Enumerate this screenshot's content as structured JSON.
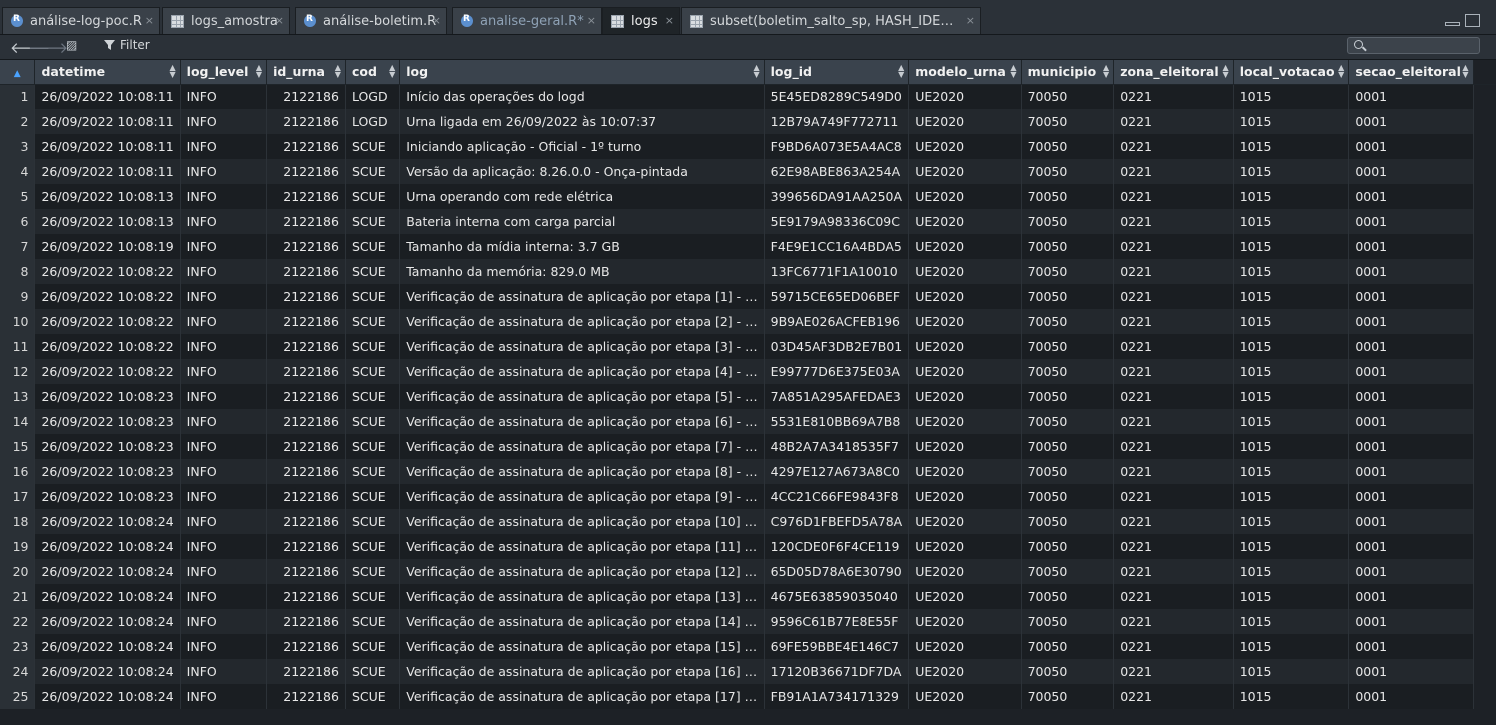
{
  "tabs": [
    {
      "label": "análise-log-poc.R",
      "icon": "r-script-icon",
      "active": false
    },
    {
      "label": "logs_amostra",
      "icon": "data-grid-icon",
      "active": false
    },
    {
      "label": "análise-boletim.R",
      "icon": "r-script-icon",
      "active": false
    },
    {
      "label": "analise-geral.R*",
      "icon": "r-script-icon",
      "active": false
    },
    {
      "label": "logs",
      "icon": "data-grid-icon",
      "active": true
    },
    {
      "label": "subset(boletim_salto_sp, HASH_IDE…",
      "icon": "data-grid-icon",
      "active": false
    }
  ],
  "toolbar": {
    "filter_label": "Filter",
    "search_placeholder": ""
  },
  "table": {
    "columns": [
      "datetime",
      "log_level",
      "id_urna",
      "cod",
      "log",
      "log_id",
      "modelo_urna",
      "municipio",
      "zona_eleitoral",
      "local_votacao",
      "secao_eleitoral"
    ],
    "rows": [
      [
        "1",
        "26/09/2022 10:08:11",
        "INFO",
        "2122186",
        "LOGD",
        "Início das operações do logd",
        "5E45ED8289C549D0",
        "UE2020",
        "70050",
        "0221",
        "1015",
        "0001"
      ],
      [
        "2",
        "26/09/2022 10:08:11",
        "INFO",
        "2122186",
        "LOGD",
        "Urna ligada em 26/09/2022 às 10:07:37",
        "12B79A749F772711",
        "UE2020",
        "70050",
        "0221",
        "1015",
        "0001"
      ],
      [
        "3",
        "26/09/2022 10:08:11",
        "INFO",
        "2122186",
        "SCUE",
        "Iniciando aplicação - Oficial - 1º turno",
        "F9BD6A073E5A4AC8",
        "UE2020",
        "70050",
        "0221",
        "1015",
        "0001"
      ],
      [
        "4",
        "26/09/2022 10:08:11",
        "INFO",
        "2122186",
        "SCUE",
        "Versão da aplicação: 8.26.0.0 - Onça-pintada",
        "62E98ABE863A254A",
        "UE2020",
        "70050",
        "0221",
        "1015",
        "0001"
      ],
      [
        "5",
        "26/09/2022 10:08:13",
        "INFO",
        "2122186",
        "SCUE",
        "Urna operando com rede elétrica",
        "399656DA91AA250A",
        "UE2020",
        "70050",
        "0221",
        "1015",
        "0001"
      ],
      [
        "6",
        "26/09/2022 10:08:13",
        "INFO",
        "2122186",
        "SCUE",
        "Bateria interna com carga parcial",
        "5E9179A98336C09C",
        "UE2020",
        "70050",
        "0221",
        "1015",
        "0001"
      ],
      [
        "7",
        "26/09/2022 10:08:19",
        "INFO",
        "2122186",
        "SCUE",
        "Tamanho da mídia interna: 3.7 GB",
        "F4E9E1CC16A4BDA5",
        "UE2020",
        "70050",
        "0221",
        "1015",
        "0001"
      ],
      [
        "8",
        "26/09/2022 10:08:22",
        "INFO",
        "2122186",
        "SCUE",
        "Tamanho da memória: 829.0 MB",
        "13FC6771F1A10010",
        "UE2020",
        "70050",
        "0221",
        "1015",
        "0001"
      ],
      [
        "9",
        "26/09/2022 10:08:22",
        "INFO",
        "2122186",
        "SCUE",
        "Verificação de assinatura de aplicação por etapa [1] - …",
        "59715CE65ED06BEF",
        "UE2020",
        "70050",
        "0221",
        "1015",
        "0001"
      ],
      [
        "10",
        "26/09/2022 10:08:22",
        "INFO",
        "2122186",
        "SCUE",
        "Verificação de assinatura de aplicação por etapa [2] - …",
        "9B9AE026ACFEB196",
        "UE2020",
        "70050",
        "0221",
        "1015",
        "0001"
      ],
      [
        "11",
        "26/09/2022 10:08:22",
        "INFO",
        "2122186",
        "SCUE",
        "Verificação de assinatura de aplicação por etapa [3] - …",
        "03D45AF3DB2E7B01",
        "UE2020",
        "70050",
        "0221",
        "1015",
        "0001"
      ],
      [
        "12",
        "26/09/2022 10:08:22",
        "INFO",
        "2122186",
        "SCUE",
        "Verificação de assinatura de aplicação por etapa [4] - …",
        "E99777D6E375E03A",
        "UE2020",
        "70050",
        "0221",
        "1015",
        "0001"
      ],
      [
        "13",
        "26/09/2022 10:08:23",
        "INFO",
        "2122186",
        "SCUE",
        "Verificação de assinatura de aplicação por etapa [5] - …",
        "7A851A295AFEDAE3",
        "UE2020",
        "70050",
        "0221",
        "1015",
        "0001"
      ],
      [
        "14",
        "26/09/2022 10:08:23",
        "INFO",
        "2122186",
        "SCUE",
        "Verificação de assinatura de aplicação por etapa [6] - …",
        "5531E810BB69A7B8",
        "UE2020",
        "70050",
        "0221",
        "1015",
        "0001"
      ],
      [
        "15",
        "26/09/2022 10:08:23",
        "INFO",
        "2122186",
        "SCUE",
        "Verificação de assinatura de aplicação por etapa [7] - …",
        "48B2A7A3418535F7",
        "UE2020",
        "70050",
        "0221",
        "1015",
        "0001"
      ],
      [
        "16",
        "26/09/2022 10:08:23",
        "INFO",
        "2122186",
        "SCUE",
        "Verificação de assinatura de aplicação por etapa [8] - …",
        "4297E127A673A8C0",
        "UE2020",
        "70050",
        "0221",
        "1015",
        "0001"
      ],
      [
        "17",
        "26/09/2022 10:08:23",
        "INFO",
        "2122186",
        "SCUE",
        "Verificação de assinatura de aplicação por etapa [9] - …",
        "4CC21C66FE9843F8",
        "UE2020",
        "70050",
        "0221",
        "1015",
        "0001"
      ],
      [
        "18",
        "26/09/2022 10:08:24",
        "INFO",
        "2122186",
        "SCUE",
        "Verificação de assinatura de aplicação por etapa [10] …",
        "C976D1FBEFD5A78A",
        "UE2020",
        "70050",
        "0221",
        "1015",
        "0001"
      ],
      [
        "19",
        "26/09/2022 10:08:24",
        "INFO",
        "2122186",
        "SCUE",
        "Verificação de assinatura de aplicação por etapa [11] …",
        "120CDE0F6F4CE119",
        "UE2020",
        "70050",
        "0221",
        "1015",
        "0001"
      ],
      [
        "20",
        "26/09/2022 10:08:24",
        "INFO",
        "2122186",
        "SCUE",
        "Verificação de assinatura de aplicação por etapa [12] …",
        "65D05D78A6E30790",
        "UE2020",
        "70050",
        "0221",
        "1015",
        "0001"
      ],
      [
        "21",
        "26/09/2022 10:08:24",
        "INFO",
        "2122186",
        "SCUE",
        "Verificação de assinatura de aplicação por etapa [13] …",
        "4675E63859035040",
        "UE2020",
        "70050",
        "0221",
        "1015",
        "0001"
      ],
      [
        "22",
        "26/09/2022 10:08:24",
        "INFO",
        "2122186",
        "SCUE",
        "Verificação de assinatura de aplicação por etapa [14] …",
        "9596C61B77E8E55F",
        "UE2020",
        "70050",
        "0221",
        "1015",
        "0001"
      ],
      [
        "23",
        "26/09/2022 10:08:24",
        "INFO",
        "2122186",
        "SCUE",
        "Verificação de assinatura de aplicação por etapa [15] …",
        "69FE59BBE4E146C7",
        "UE2020",
        "70050",
        "0221",
        "1015",
        "0001"
      ],
      [
        "24",
        "26/09/2022 10:08:24",
        "INFO",
        "2122186",
        "SCUE",
        "Verificação de assinatura de aplicação por etapa [16] …",
        "17120B36671DF7DA",
        "UE2020",
        "70050",
        "0221",
        "1015",
        "0001"
      ],
      [
        "25",
        "26/09/2022 10:08:24",
        "INFO",
        "2122186",
        "SCUE",
        "Verificação de assinatura de aplicação por etapa [17] …",
        "FB91A1A734171329",
        "UE2020",
        "70050",
        "0221",
        "1015",
        "0001"
      ]
    ]
  }
}
